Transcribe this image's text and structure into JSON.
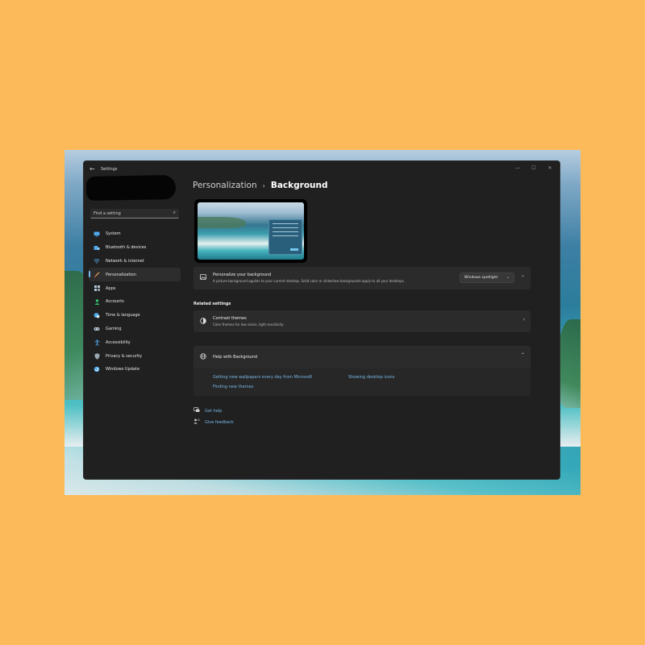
{
  "app": {
    "title": "Settings",
    "back_icon": "back-arrow-icon",
    "controls": [
      "—",
      "☐",
      "✕"
    ]
  },
  "search": {
    "placeholder": "Find a setting"
  },
  "sidebar": {
    "items": [
      {
        "label": "System",
        "icon": "monitor-icon",
        "color": "#4fa8e8"
      },
      {
        "label": "Bluetooth & devices",
        "icon": "bluetooth-icon",
        "color": "#4fa8e8"
      },
      {
        "label": "Network & internet",
        "icon": "wifi-icon",
        "color": "#4fa8e8"
      },
      {
        "label": "Personalization",
        "icon": "brush-icon",
        "color": "#e8a055",
        "active": true
      },
      {
        "label": "Apps",
        "icon": "apps-icon",
        "color": "#b7c7d8"
      },
      {
        "label": "Accounts",
        "icon": "person-icon",
        "color": "#33c26b"
      },
      {
        "label": "Time & language",
        "icon": "globe-clock-icon",
        "color": "#4fa8e8"
      },
      {
        "label": "Gaming",
        "icon": "gamepad-icon",
        "color": "#b7c7d8"
      },
      {
        "label": "Accessibility",
        "icon": "accessibility-icon",
        "color": "#4fa8e8"
      },
      {
        "label": "Privacy & security",
        "icon": "shield-icon",
        "color": "#9aa7b3"
      },
      {
        "label": "Windows Update",
        "icon": "update-icon",
        "color": "#4fa8e8"
      }
    ]
  },
  "breadcrumb": {
    "parent": "Personalization",
    "separator": "›",
    "current": "Background"
  },
  "personalize_card": {
    "title": "Personalize your background",
    "description": "A picture background applies to your current desktop. Solid color or slideshow backgrounds apply to all your desktops.",
    "dropdown_value": "Windows spotlight"
  },
  "related_settings": {
    "label": "Related settings",
    "contrast": {
      "title": "Contrast themes",
      "description": "Color themes for low vision, light sensitivity"
    }
  },
  "help": {
    "title": "Help with Background",
    "links": [
      "Getting new wallpapers every day from Microsoft",
      "Showing desktop icons",
      "Finding new themes"
    ]
  },
  "footer": {
    "get_help": "Get help",
    "feedback": "Give feedback"
  },
  "colors": {
    "accent": "#77b7e6",
    "window_bg": "#202020",
    "card_bg": "#2b2b2b",
    "page_bg": "#fdba5a"
  }
}
